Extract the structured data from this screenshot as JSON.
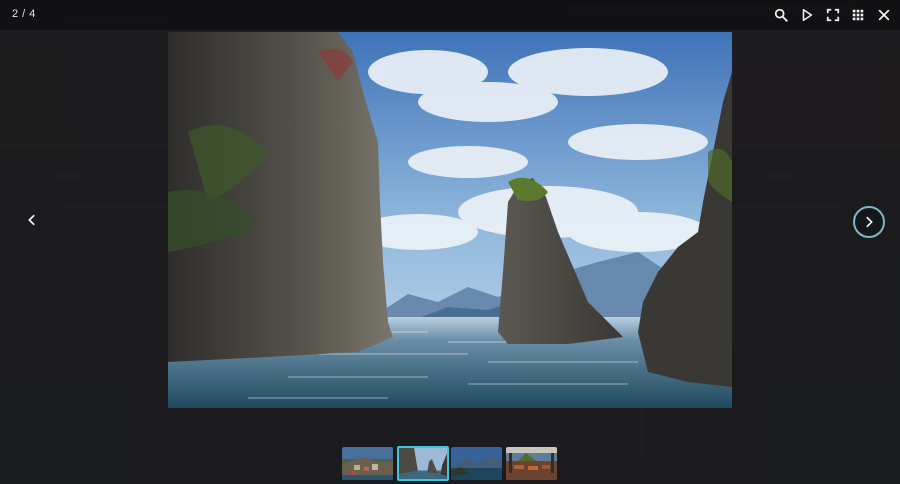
{
  "lightbox": {
    "counter": "2 / 4",
    "toolbar": {
      "zoom": "search-icon",
      "slideshow": "play-icon",
      "fullscreen": "fullscreen-icon",
      "thumbnails": "grid-icon",
      "close": "close-icon"
    },
    "current_index": 2,
    "total": 4,
    "thumbnails": [
      {
        "id": "coastal-village"
      },
      {
        "id": "sea-rocks"
      },
      {
        "id": "mountain-bay"
      },
      {
        "id": "restaurant-terrace"
      }
    ]
  },
  "colors": {
    "accent": "#3cc6e3",
    "next_ring": "#7fb6c9",
    "overlay": "#1b1c1e"
  }
}
